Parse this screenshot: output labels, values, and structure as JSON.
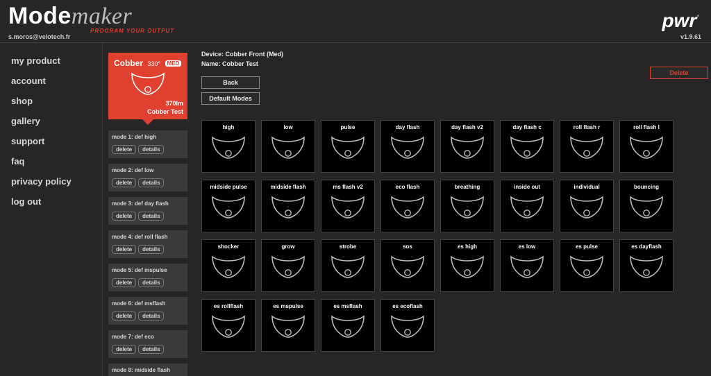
{
  "brand": {
    "word1": "Mode",
    "word2": "maker",
    "tagline": "PROGRAM YOUR OUTPUT"
  },
  "user_email": "s.moros@velotech.fr",
  "right_brand": "pwr",
  "version": "v1.9.61",
  "nav": [
    {
      "label": "my product"
    },
    {
      "label": "account"
    },
    {
      "label": "shop"
    },
    {
      "label": "gallery"
    },
    {
      "label": "support"
    },
    {
      "label": "faq"
    },
    {
      "label": "privacy policy"
    },
    {
      "label": "log out"
    }
  ],
  "product_card": {
    "title": "Cobber",
    "angle": "330°",
    "badge": "MED",
    "lumen": "370lm",
    "name": "Cobber Test"
  },
  "mode_list": {
    "delete_label": "delete",
    "details_label": "details",
    "items": [
      {
        "label": "mode 1: def high"
      },
      {
        "label": "mode 2: def low"
      },
      {
        "label": "mode 3: def day flash"
      },
      {
        "label": "mode 4: def roll flash"
      },
      {
        "label": "mode 5: def mspulse"
      },
      {
        "label": "mode 6: def msflash"
      },
      {
        "label": "mode 7: def eco"
      },
      {
        "label": "mode 8: midside flash"
      }
    ]
  },
  "device": {
    "label": "Device:",
    "value": "Cobber Front (Med)"
  },
  "name": {
    "label": "Name:",
    "value": "Cobber Test"
  },
  "buttons": {
    "back": "Back",
    "default_modes": "Default Modes",
    "delete": "Delete"
  },
  "tiles": [
    [
      "high",
      "low",
      "pulse",
      "day flash",
      "day flash v2",
      "day flash c",
      "roll flash r",
      "roll flash l"
    ],
    [
      "midside pulse",
      "midside flash",
      "ms flash v2",
      "eco flash",
      "breathing",
      "inside out",
      "individual",
      "bouncing"
    ],
    [
      "shocker",
      "grow",
      "strobe",
      "sos",
      "es high",
      "es low",
      "es pulse",
      "es dayflash"
    ],
    [
      "es rollflash",
      "es mspulse",
      "es msflash",
      "es ecoflash"
    ]
  ]
}
